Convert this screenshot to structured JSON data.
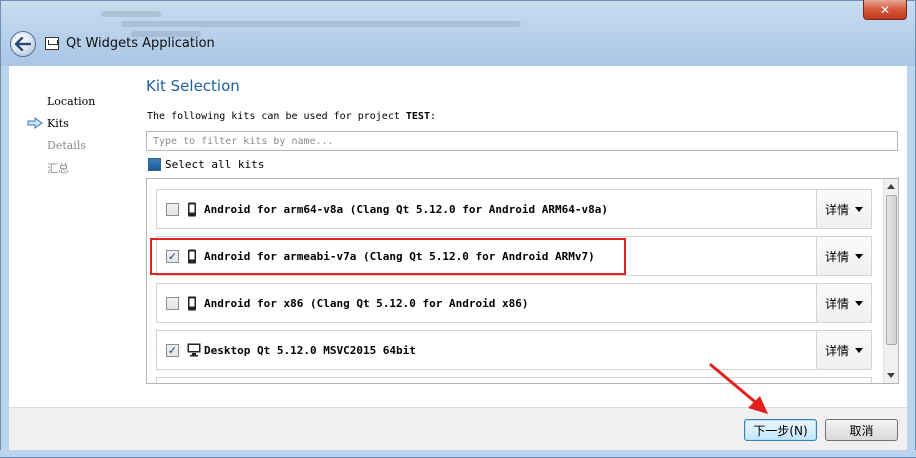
{
  "window": {
    "title": "Qt Widgets Application",
    "close_glyph": "✕"
  },
  "steps": [
    {
      "label": "Location",
      "state": "done"
    },
    {
      "label": "Kits",
      "state": "current"
    },
    {
      "label": "Details",
      "state": "pending"
    },
    {
      "label": "汇总",
      "state": "pending"
    }
  ],
  "page": {
    "title": "Kit Selection",
    "description_prefix": "The following kits can be used for project ",
    "project_name": "TEST",
    "description_suffix": ":",
    "filter_placeholder": "Type to filter kits by name...",
    "select_all_label": "Select all kits"
  },
  "kits": [
    {
      "name": "Android for arm64-v8a (Clang Qt 5.12.0 for Android ARM64-v8a)",
      "checked": false,
      "icon": "phone-icon",
      "details_label": "详情"
    },
    {
      "name": "Android for armeabi-v7a (Clang Qt 5.12.0 for Android ARMv7)",
      "checked": true,
      "icon": "phone-icon",
      "details_label": "详情"
    },
    {
      "name": "Android for x86 (Clang Qt 5.12.0 for Android x86)",
      "checked": false,
      "icon": "phone-icon",
      "details_label": "详情"
    },
    {
      "name": "Desktop Qt 5.12.0 MSVC2015 64bit",
      "checked": true,
      "icon": "monitor-icon",
      "details_label": "详情"
    }
  ],
  "footer": {
    "next_label": "下一步(N)",
    "cancel_label": "取消"
  },
  "colors": {
    "title_accent": "#1f5fa0",
    "highlight": "#e32020"
  }
}
